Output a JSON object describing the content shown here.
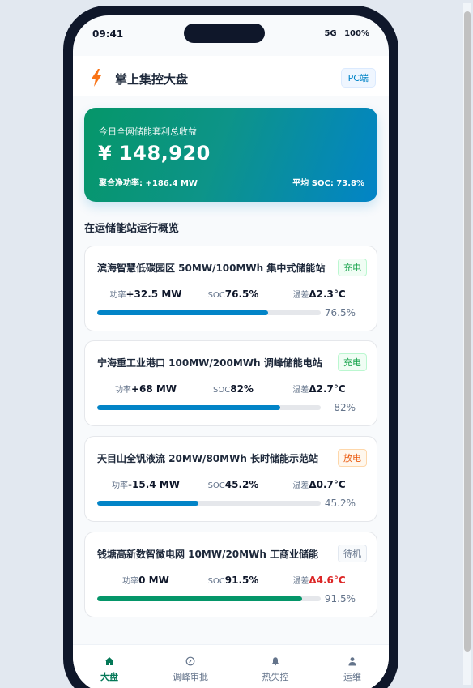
{
  "status_bar": {
    "time": "09:41",
    "network": "5G",
    "battery": "100%"
  },
  "app_bar": {
    "title": "掌上集控大盘",
    "pc_button": "PC端",
    "logo_icon": "lightning-icon"
  },
  "hero": {
    "label": "今日全网储能套利总收益",
    "amount": "¥ 148,920",
    "net_power": "聚合净功率: +186.4 MW",
    "avg_soc": "平均 SOC: 73.8%"
  },
  "section_title": "在运储能站运行概览",
  "stations": [
    {
      "name": "滨海智慧低碳园区 50MW/100MWh 集中式储能站",
      "status": "充电",
      "status_type": "charge",
      "power_label": "功率",
      "power": "+32.5 MW",
      "soc_label": "SOC",
      "soc": "76.5%",
      "temp_label": "温差",
      "temp": "Δ2.3°C",
      "temp_alert": false,
      "progress": 76.5,
      "progress_text": "76.5%"
    },
    {
      "name": "宁海重工业港口 100MW/200MWh 调峰储能电站",
      "status": "充电",
      "status_type": "charge",
      "power_label": "功率",
      "power": "+68 MW",
      "soc_label": "SOC",
      "soc": "82%",
      "temp_label": "温差",
      "temp": "Δ2.7°C",
      "temp_alert": false,
      "progress": 82,
      "progress_text": "82%"
    },
    {
      "name": "天目山全钒液流 20MW/80MWh 长时储能示范站",
      "status": "放电",
      "status_type": "discharge",
      "power_label": "功率",
      "power": "-15.4 MW",
      "soc_label": "SOC",
      "soc": "45.2%",
      "temp_label": "温差",
      "temp": "Δ0.7°C",
      "temp_alert": false,
      "progress": 45.2,
      "progress_text": "45.2%"
    },
    {
      "name": "钱塘高新数智微电网 10MW/20MWh 工商业储能",
      "status": "待机",
      "status_type": "idle",
      "power_label": "功率",
      "power": "0 MW",
      "soc_label": "SOC",
      "soc": "91.5%",
      "temp_label": "温差",
      "temp": "Δ4.6°C",
      "temp_alert": true,
      "progress": 91.5,
      "progress_text": "91.5%"
    }
  ],
  "tabs": [
    {
      "label": "大盘",
      "icon": "home-icon",
      "active": true
    },
    {
      "label": "调峰审批",
      "icon": "compass-icon",
      "active": false
    },
    {
      "label": "热失控",
      "icon": "bell-icon",
      "active": false
    },
    {
      "label": "运维",
      "icon": "user-icon",
      "active": false
    }
  ],
  "colors": {
    "accent": "#0284c7",
    "brand_green": "#059669",
    "charge": "#16a34a",
    "discharge": "#ea580c",
    "idle": "#64748b",
    "alert": "#dc2626"
  }
}
